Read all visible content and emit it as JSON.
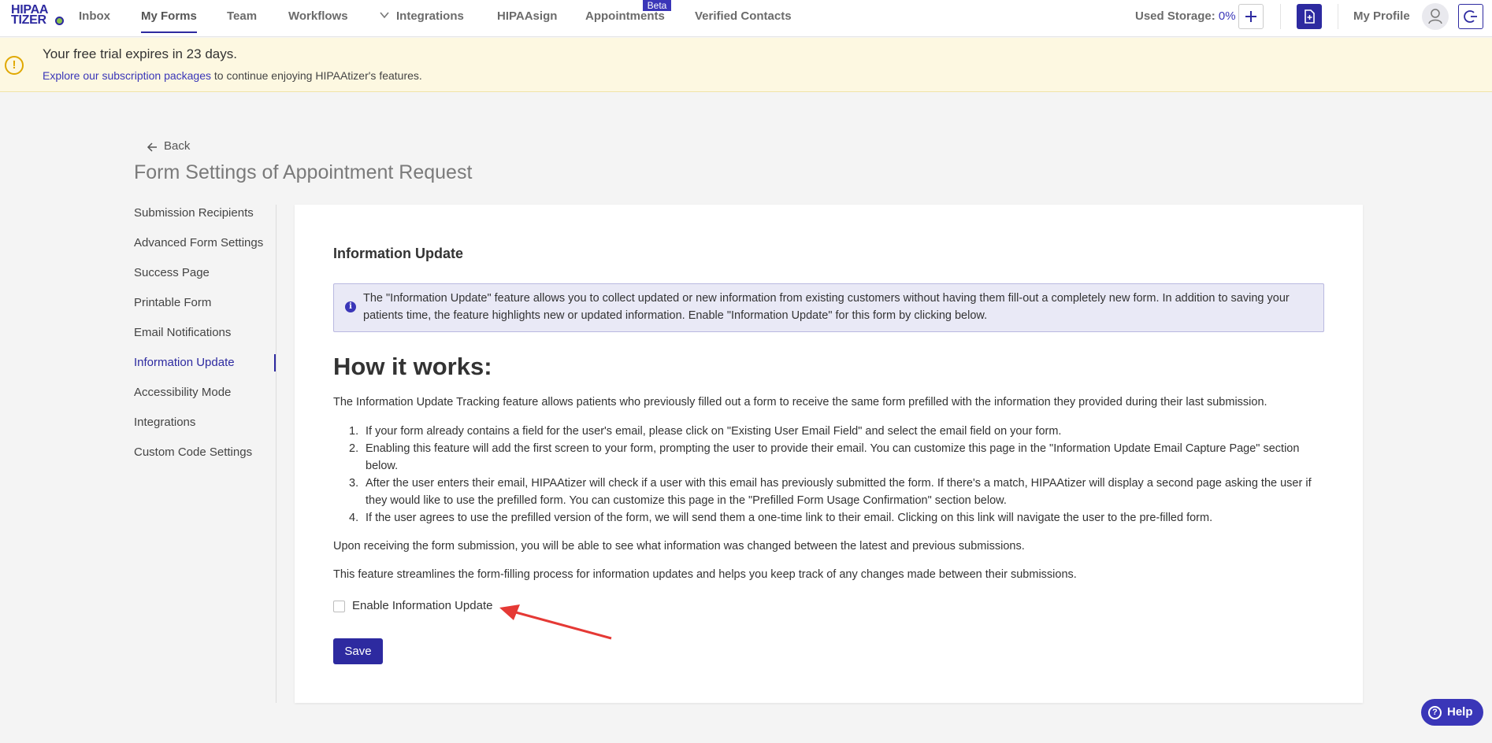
{
  "logo": {
    "line1": "HIPAA",
    "line2": "TIZER"
  },
  "nav": {
    "inbox": "Inbox",
    "my_forms": "My Forms",
    "team": "Team",
    "workflows": "Workflows",
    "integrations": "Integrations",
    "hipaasign": "HIPAAsign",
    "appointments": "Appointments",
    "beta": "Beta",
    "verified_contacts": "Verified Contacts",
    "storage_label": "Used Storage:",
    "storage_value": "0%",
    "my_profile": "My Profile"
  },
  "banner": {
    "title": "Your free trial expires in 23 days.",
    "link": "Explore our subscription packages",
    "rest": " to continue enjoying HIPAAtizer's features.",
    "warning_symbol": "!"
  },
  "header": {
    "back": "Back",
    "title": "Form Settings of Appointment Request"
  },
  "sidebar": {
    "items": [
      {
        "label": "Submission Recipients"
      },
      {
        "label": "Advanced Form Settings"
      },
      {
        "label": "Success Page"
      },
      {
        "label": "Printable Form"
      },
      {
        "label": "Email Notifications"
      },
      {
        "label": "Information Update"
      },
      {
        "label": "Accessibility Mode"
      },
      {
        "label": "Integrations"
      },
      {
        "label": "Custom Code Settings"
      }
    ],
    "active_index": 5
  },
  "main": {
    "section_title": "Information Update",
    "info_symbol": "i",
    "info_text": "The \"Information Update\" feature allows you to collect updated or new information from existing customers without having them fill-out a completely new form. In addition to saving your patients time, the feature highlights new or updated information. Enable \"Information Update\" for this form by clicking below.",
    "how_title": "How it works:",
    "intro": "The Information Update Tracking feature allows patients who previously filled out a form to receive the same form prefilled with the information they provided during their last submission.",
    "steps": [
      {
        "num": "1.",
        "text": "If your form already contains a field for the user's email, please click on \"Existing User Email Field\" and select the email field on your form."
      },
      {
        "num": "2.",
        "text": "Enabling this feature will add the first screen to your form, prompting the user to provide their email. You can customize this page in the \"Information Update Email Capture Page\" section below."
      },
      {
        "num": "3.",
        "text": "After the user enters their email, HIPAAtizer will check if a user with this email has previously submitted the form. If there's a match, HIPAAtizer will display a second page asking the user if they would like to use the prefilled form. You can customize this page in the \"Prefilled Form Usage Confirmation\" section below."
      },
      {
        "num": "4.",
        "text": "If the user agrees to use the prefilled version of the form, we will send them a one-time link to their email. Clicking on this link will navigate the user to the pre-filled form."
      }
    ],
    "para1": "Upon receiving the form submission, you will be able to see what information was changed between the latest and previous submissions.",
    "para2": "This feature streamlines the form-filling process for information updates and helps you keep track of any changes made between their submissions.",
    "checkbox_label": "Enable Information Update",
    "checkbox_checked": false,
    "save": "Save"
  },
  "help": {
    "label": "Help",
    "symbol": "?"
  },
  "colors": {
    "brand": "#2d2aa0",
    "banner_bg": "#fdf8e1",
    "warning": "#e0a800",
    "annotation_arrow": "#e53935"
  }
}
